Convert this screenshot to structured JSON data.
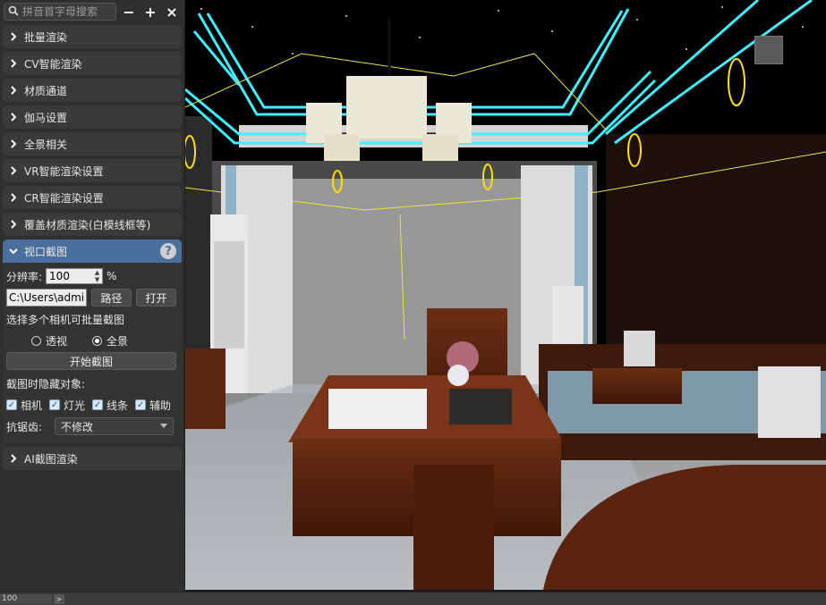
{
  "panel": {
    "search_placeholder": "拼音首字母搜索",
    "minimize_label": "−",
    "add_label": "+",
    "close_label": "×",
    "sections": [
      {
        "label": "批量渲染"
      },
      {
        "label": "CV智能渲染"
      },
      {
        "label": "材质通道"
      },
      {
        "label": "伽马设置"
      },
      {
        "label": "全景相关"
      },
      {
        "label": "VR智能渲染设置"
      },
      {
        "label": "CR智能渲染设置"
      },
      {
        "label": "覆盖材质渲染(白模线框等)"
      }
    ],
    "open_section": {
      "label": "视口截图",
      "help_label": "?",
      "resolution_label": "分辨率:",
      "resolution_value": "100",
      "resolution_unit": "%",
      "path_value": "C:\\Users\\admin",
      "path_button": "路径",
      "open_button": "打开",
      "multi_camera_hint": "选择多个相机可批量截图",
      "radio_perspective": "透视",
      "radio_panorama": "全景",
      "radio_selected": "全景",
      "start_button": "开始截图",
      "hide_objects_label": "截图时隐藏对象:",
      "checkboxes": [
        {
          "label": "相机",
          "checked": true
        },
        {
          "label": "灯光",
          "checked": true
        },
        {
          "label": "线条",
          "checked": true
        },
        {
          "label": "辅助",
          "checked": true
        }
      ],
      "antialias_label": "抗锯齿:",
      "antialias_value": "不修改"
    },
    "last_section": {
      "label": "AI截图渲染"
    }
  },
  "statusbar": {
    "field_value": "100",
    "arrow_label": ">"
  }
}
